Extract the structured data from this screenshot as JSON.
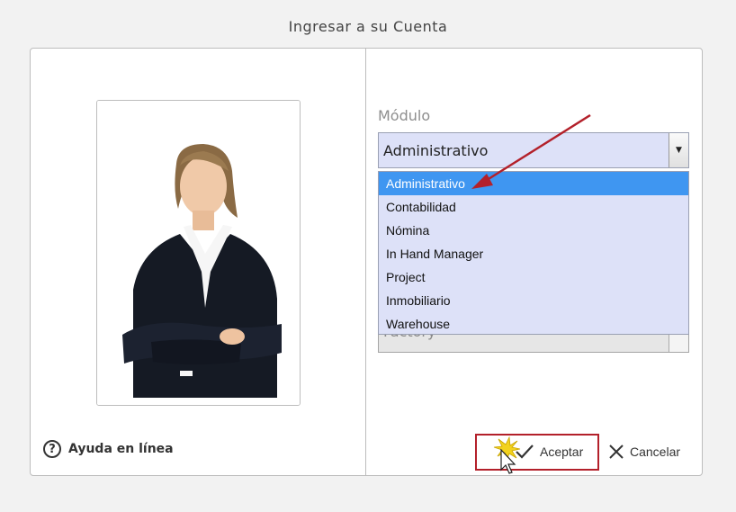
{
  "dialog": {
    "title": "Ingresar a su Cuenta"
  },
  "help": {
    "label": "Ayuda en línea",
    "icon_glyph": "?"
  },
  "module": {
    "label": "Módulo",
    "selected": "Administrativo",
    "arrow_glyph": "▼",
    "partial_field_text": "Factory",
    "options": [
      "Administrativo",
      "Contabilidad",
      "Nómina",
      "In Hand Manager",
      "Project",
      "Inmobiliario",
      "Warehouse"
    ]
  },
  "actions": {
    "accept_label": "Aceptar",
    "cancel_label": "Cancelar"
  },
  "colors": {
    "selected_option": "#3f96f1",
    "dropdown_bg": "#dde1f8",
    "highlight_border": "#b3202a",
    "annotation_arrow": "#b3202a"
  }
}
